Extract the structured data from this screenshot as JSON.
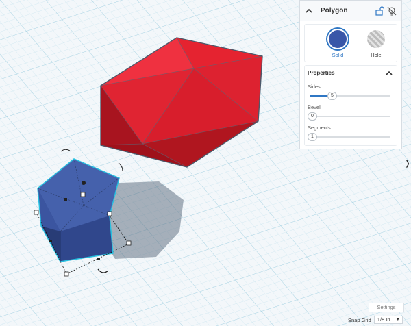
{
  "panel": {
    "title": "Polygon",
    "lock_icon": "unlock-icon",
    "light_icon": "lightbulb-off-icon",
    "modes": [
      {
        "label": "Solid",
        "selected": true,
        "color": "#3957a8"
      },
      {
        "label": "Hole",
        "selected": false
      }
    ],
    "properties": {
      "title": "Properties",
      "fields": [
        {
          "label": "Sides",
          "value": "5",
          "fraction": 0.15
        },
        {
          "label": "Bevel",
          "value": "0",
          "fraction": 0.0
        },
        {
          "label": "Segments",
          "value": "1",
          "fraction": 0.0
        }
      ]
    }
  },
  "footer": {
    "settings_label": "Settings",
    "snap_grid_label": "Snap Grid",
    "snap_grid_value": "1/8 In"
  },
  "scene": {
    "shapes": [
      {
        "name": "red-polyhedron",
        "color": "#e52330"
      },
      {
        "name": "blue-pentagonal-prism",
        "color": "#3f5aa8",
        "selected": true
      }
    ],
    "accent": "#2f77c4"
  }
}
